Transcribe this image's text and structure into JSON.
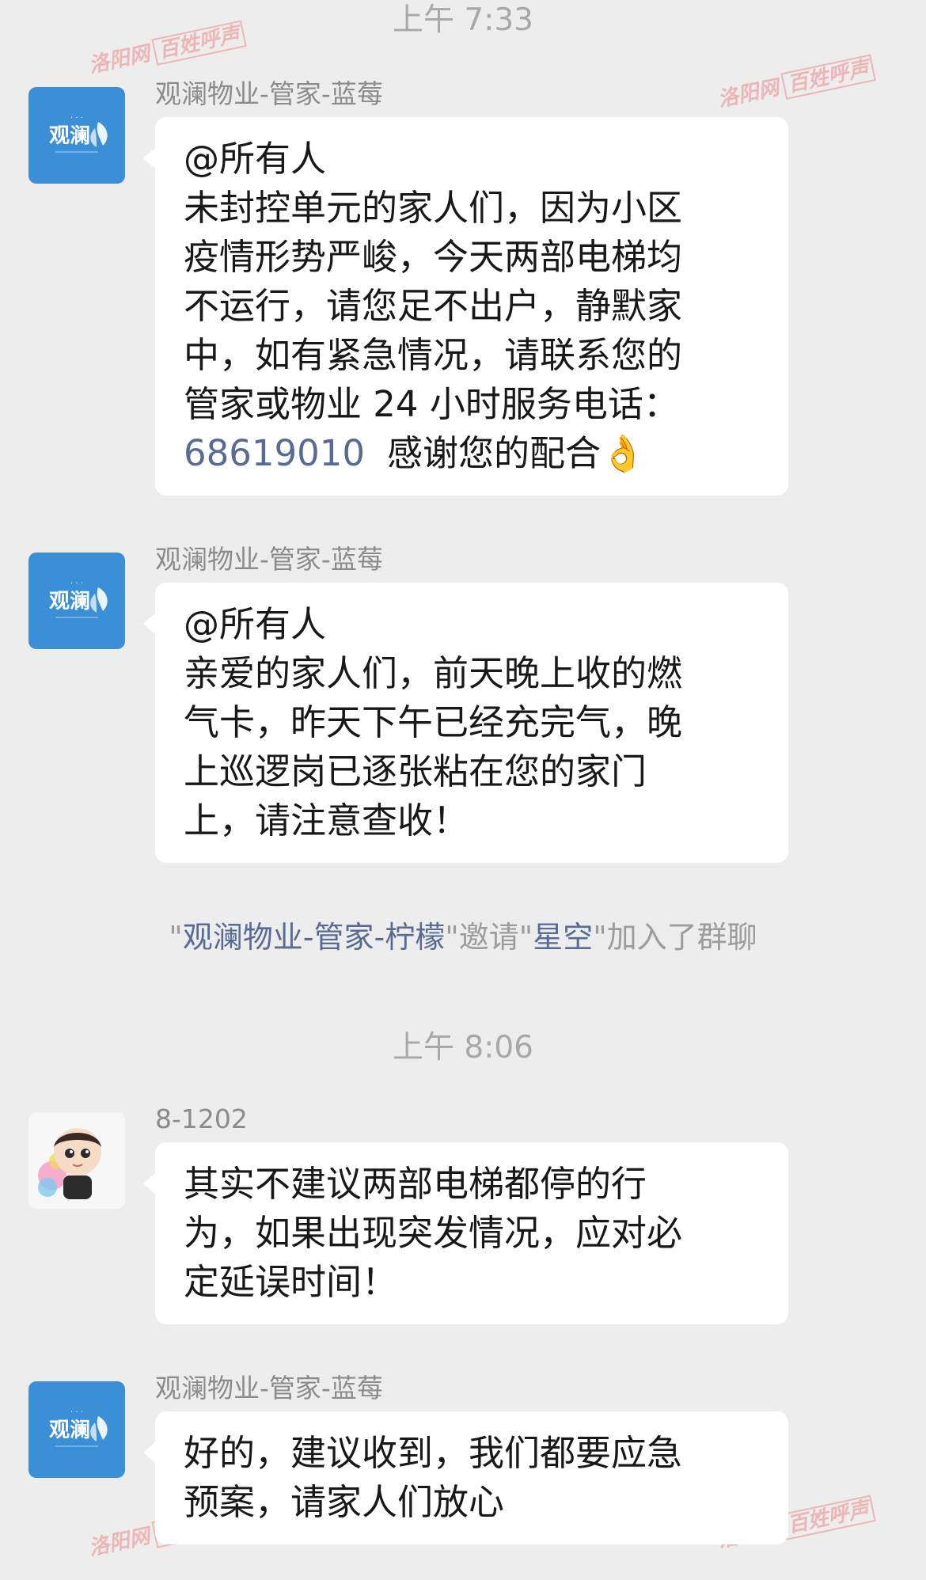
{
  "accent_link_color": "#576b95",
  "watermark": {
    "site": "洛阳网",
    "channel": "百姓呼声"
  },
  "timestamps": [
    "上午 7:33",
    "上午 8:06"
  ],
  "messages": [
    {
      "sender": "观澜物业-管家-蓝莓",
      "avatar": "guanlan-logo",
      "lines": [
        "@所有人",
        "未封控单元的家人们，因为小区",
        "疫情形势严峻，今天两部电梯均",
        "不运行，请您足不出户，静默家",
        "中，如有紧急情况，请联系您的",
        "管家或物业 24 小时服务电话："
      ],
      "phone": "68619010",
      "tail": "感谢您的配合👌"
    },
    {
      "sender": "观澜物业-管家-蓝莓",
      "avatar": "guanlan-logo",
      "lines": [
        "@所有人",
        "亲爱的家人们，前天晚上收的燃",
        "气卡，昨天下午已经充完气，晚",
        "上巡逻岗已逐张粘在您的家门",
        "上，请注意查收！"
      ]
    },
    {
      "sender": "8-1202",
      "avatar": "child-cartoon",
      "lines": [
        "其实不建议两部电梯都停的行",
        "为，如果出现突发情况，应对必",
        "定延误时间！"
      ]
    },
    {
      "sender": "观澜物业-管家-蓝莓",
      "avatar": "guanlan-logo",
      "lines": [
        "好的，建议收到，我们都要应急",
        "预案，请家人们放心"
      ]
    }
  ],
  "system_notice": {
    "q1": "\"",
    "inviter": "观澜物业-管家-柠檬",
    "mid": "\"邀请\"",
    "invitee": "星空",
    "end": "\"加入了群聊"
  }
}
